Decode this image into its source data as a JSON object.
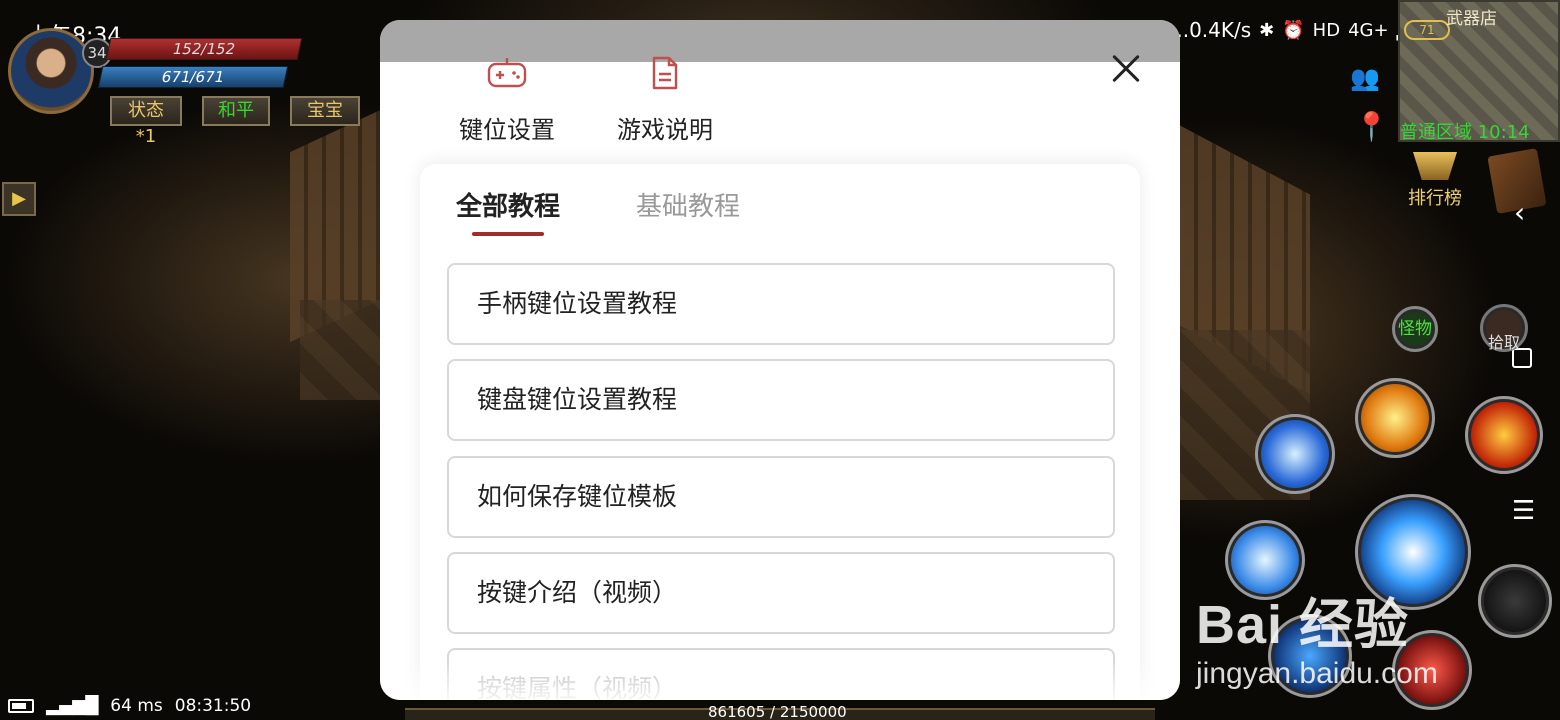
{
  "status_bar": {
    "time": "上午8:34",
    "network_speed": "...0.4K/s",
    "network_type": "4G+",
    "hd": "HD"
  },
  "player": {
    "level": "34",
    "hp": "152/152",
    "mp": "671/671",
    "buttons": {
      "status": "状态*1",
      "mode": "和平",
      "pet": "宝宝"
    }
  },
  "minimap": {
    "title": "武器店",
    "zone_coords": "普通区域 10:14",
    "badge": "71"
  },
  "right_hud": {
    "ranking": "排行榜",
    "monster_skill": "怪物",
    "pickup_skill": "拾取"
  },
  "bottom_bar": {
    "ping": "64 ms",
    "clock": "08:31:50",
    "exp": "861605 / 2150000"
  },
  "watermark": {
    "main": "Bai 经验",
    "sub": "jingyan.baidu.com"
  },
  "modal": {
    "top_tabs": [
      {
        "label": "键位设置",
        "icon": "gamepad-icon"
      },
      {
        "label": "游戏说明",
        "icon": "document-icon"
      }
    ],
    "sub_tabs": [
      {
        "label": "全部教程",
        "active": true
      },
      {
        "label": "基础教程",
        "active": false
      }
    ],
    "tutorials": [
      "手柄键位设置教程",
      "键盘键位设置教程",
      "如何保存键位模板",
      "按键介绍（视频）",
      "按键属性（视频）"
    ],
    "accent_color": "#a52a2a"
  }
}
